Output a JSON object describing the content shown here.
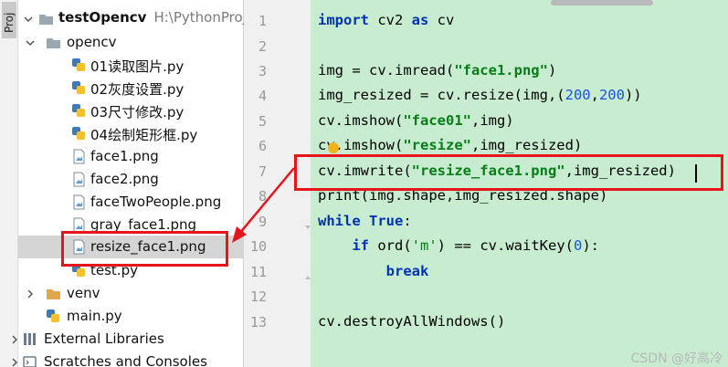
{
  "tool_strip": {
    "label": "Proj"
  },
  "project": {
    "name": "testOpencv",
    "path": "H:\\PythonProject",
    "folders": {
      "opencv": "opencv",
      "venv": "venv"
    },
    "files": [
      {
        "name": "01读取图片.py",
        "type": "py"
      },
      {
        "name": "02灰度设置.py",
        "type": "py"
      },
      {
        "name": "03尺寸修改.py",
        "type": "py"
      },
      {
        "name": "04绘制矩形框.py",
        "type": "py"
      },
      {
        "name": "face1.png",
        "type": "png"
      },
      {
        "name": "face2.png",
        "type": "png"
      },
      {
        "name": "faceTwoPeople.png",
        "type": "png"
      },
      {
        "name": "gray_face1.png",
        "type": "png"
      },
      {
        "name": "resize_face1.png",
        "type": "png"
      },
      {
        "name": "test.py",
        "type": "py"
      }
    ],
    "main_file": "main.py",
    "external_libraries": "External Libraries",
    "scratches": "Scratches and Consoles"
  },
  "editor": {
    "line_numbers": [
      "1",
      "2",
      "3",
      "4",
      "5",
      "6",
      "7",
      "8",
      "9",
      "10",
      "11",
      "12",
      "13"
    ],
    "code": {
      "l1": {
        "kw1": "import",
        "mid": " cv2 ",
        "kw2": "as",
        "end": " cv"
      },
      "l3": {
        "pre": "img = cv.imread(",
        "str": "\"face1.png\"",
        "end": ")"
      },
      "l4": {
        "pre": "img_resized = cv.resize(img,(",
        "n1": "200",
        "comma": ",",
        "n2": "200",
        "end": "))"
      },
      "l5": {
        "pre": "cv.imshow(",
        "str": "\"face01\"",
        "end": ",img)"
      },
      "l6": {
        "pre": "cv.imshow(",
        "str": "\"resize\"",
        "end": ",img_resized)"
      },
      "l7": {
        "pre": "cv.imwrite(",
        "str": "\"resize_face1.png\"",
        "end": ",img_resized)"
      },
      "l8": {
        "text": "print(img.shape,img_resized.shape)"
      },
      "l9": {
        "kw1": "while",
        "sp": " ",
        "kw2": "True",
        "end": ":"
      },
      "l10": {
        "indent": "    ",
        "kw": "if",
        "pre": " ord(",
        "str": "'m'",
        "mid": ") == cv.waitKey(",
        "num": "0",
        "end": "):"
      },
      "l11": {
        "indent": "        ",
        "kw": "break"
      },
      "l13": {
        "text": "cv.destroyAllWindows()"
      }
    }
  },
  "watermark": "CSDN @好高冷",
  "colors": {
    "editor_bg": "#c7ecd0",
    "annotation_red": "#e8141b",
    "selected_row": "#d5d5d5"
  }
}
